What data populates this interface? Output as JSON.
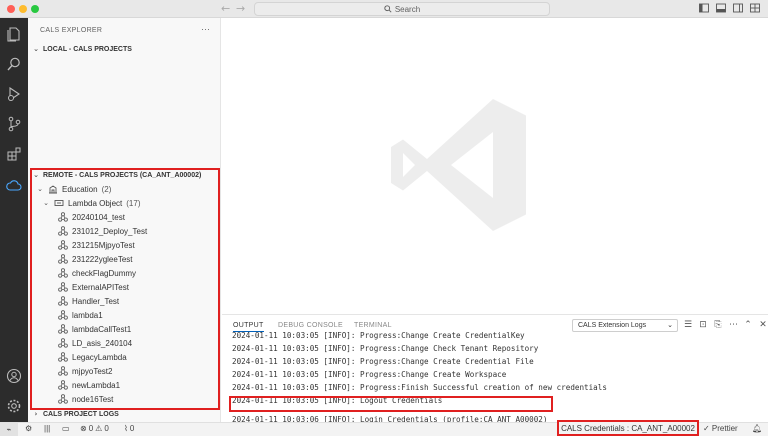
{
  "titlebar": {
    "search_label": "Search",
    "back_arrow": "←",
    "forward_arrow": "→"
  },
  "activitybar": {
    "icons": [
      "explorer-icon",
      "search-icon",
      "run-debug-icon",
      "source-control-icon",
      "extensions-icon",
      "cloud-icon",
      "account-icon",
      "settings-icon"
    ]
  },
  "sidebar": {
    "title": "CALS EXPLORER",
    "more": "···",
    "local_section": "LOCAL - CALS PROJECTS",
    "remote_section": "REMOTE - CALS PROJECTS (CA_ANT_A00002)",
    "education_label": "Education",
    "education_count": "(2)",
    "lambda_label": "Lambda Object",
    "lambda_count": "(17)",
    "items": [
      "20240104_test",
      "231012_Deploy_Test",
      "231215MjpyoTest",
      "231222ygleeTest",
      "checkFlagDummy",
      "ExternalAPITest",
      "Handler_Test",
      "lambda1",
      "lambdaCallTest1",
      "LD_asis_240104",
      "LegacyLambda",
      "mjpyoTest2",
      "newLambda1",
      "node16Test"
    ],
    "project_logs": "CALS PROJECT LOGS"
  },
  "panel": {
    "tabs": [
      "OUTPUT",
      "DEBUG CONSOLE",
      "TERMINAL"
    ],
    "select_value": "CALS Extension Logs",
    "log_lines": [
      "2024-01-11 10:03:05 [INFO]: Progress:Change Create CredentialKey",
      "2024-01-11 10:03:05 [INFO]: Progress:Change Check Tenant Repository",
      "2024-01-11 10:03:05 [INFO]: Progress:Change Create Credential File",
      "2024-01-11 10:03:05 [INFO]: Progress:Change Create Workspace",
      "2024-01-11 10:03:05 [INFO]: Progress:Finish Successful creation of new credentials",
      "2024-01-11 10:03:05 [INFO]: Logout Credentials",
      "2024-01-11 10:03:06 [INFO]: Login Credentials (profile:CA_ANT_A00002)"
    ]
  },
  "statusbar": {
    "remote": "⌁",
    "errors": "0",
    "warnings": "0",
    "ports": "0",
    "credentials": "CALS Credentials : CA_ANT_A00002",
    "prettier": "✓ Prettier"
  },
  "colors": {
    "highlight_red": "#e02020",
    "activity_bg": "#2c2c2c",
    "accent": "#005fb8"
  }
}
